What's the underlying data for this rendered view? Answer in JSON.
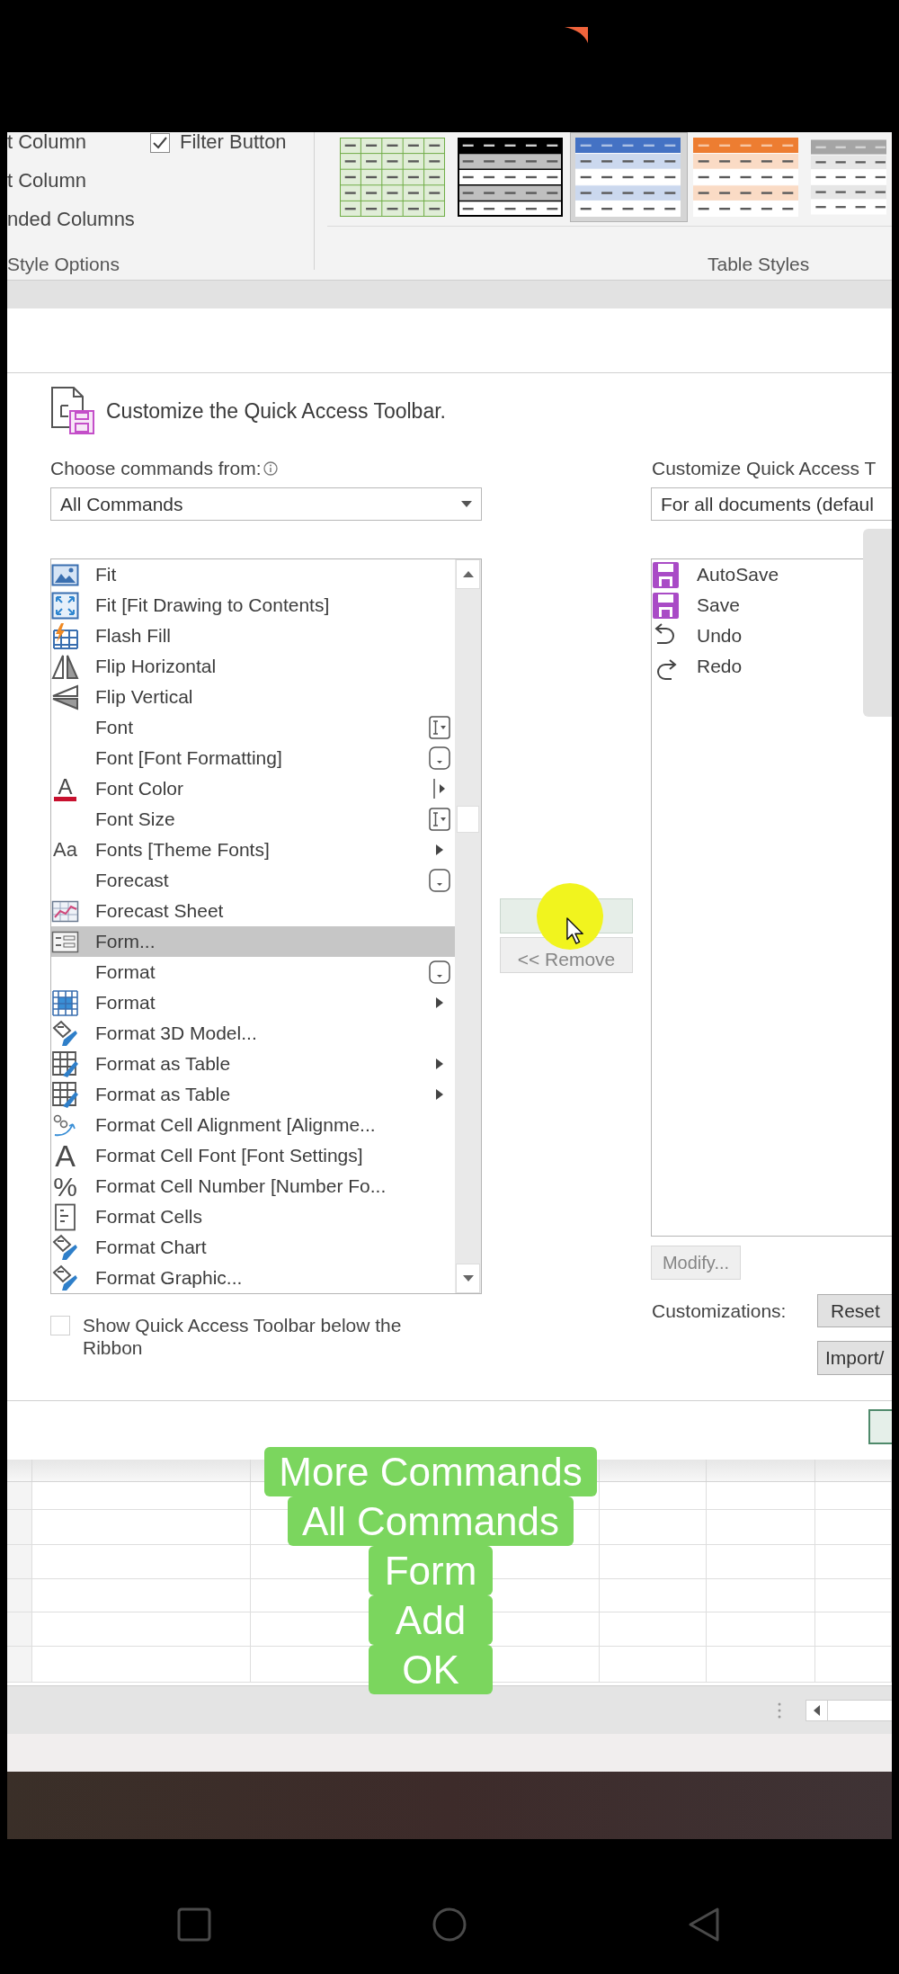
{
  "ribbon": {
    "style_options": {
      "items": [
        "t Column",
        "t Column",
        "nded Columns"
      ],
      "filter_button": {
        "label": "Filter Button",
        "checked": true
      },
      "group_label": "Style Options"
    },
    "table_styles": {
      "items": [
        {
          "kind": "light",
          "color": "#70ad47",
          "selected": false
        },
        {
          "kind": "bordered",
          "color": "#000000",
          "selected": false
        },
        {
          "kind": "banded",
          "color": "#4472c4",
          "selected": true
        },
        {
          "kind": "banded",
          "color": "#ed7d31",
          "selected": false
        },
        {
          "kind": "banded",
          "color": "#a5a5a5",
          "selected": false
        }
      ],
      "group_label": "Table Styles"
    }
  },
  "dialog": {
    "heading": "Customize the Quick Access Toolbar.",
    "choose_label": "Choose commands from:",
    "choose_value": "All Commands",
    "customize_label": "Customize Quick Access T",
    "customize_value": "For all documents (defaul",
    "commands": [
      {
        "label": "Fit",
        "kind": "plain",
        "selected": false
      },
      {
        "label": "Fit [Fit Drawing to Contents]",
        "kind": "plain",
        "selected": false
      },
      {
        "label": "Flash Fill",
        "kind": "plain",
        "selected": false
      },
      {
        "label": "Flip Horizontal",
        "kind": "plain",
        "selected": false
      },
      {
        "label": "Flip Vertical",
        "kind": "plain",
        "selected": false
      },
      {
        "label": "Font",
        "kind": "combo",
        "selected": false
      },
      {
        "label": "Font [Font Formatting]",
        "kind": "menu",
        "selected": false
      },
      {
        "label": "Font Color",
        "kind": "split",
        "selected": false,
        "glyph": "A"
      },
      {
        "label": "Font Size",
        "kind": "combo",
        "selected": false
      },
      {
        "label": "Fonts [Theme Fonts]",
        "kind": "submenu",
        "selected": false,
        "glyph": "Aa"
      },
      {
        "label": "Forecast",
        "kind": "menu",
        "selected": false
      },
      {
        "label": "Forecast Sheet",
        "kind": "plain",
        "selected": false
      },
      {
        "label": "Form...",
        "kind": "plain",
        "selected": true
      },
      {
        "label": "Format",
        "kind": "menu",
        "selected": false
      },
      {
        "label": "Format",
        "kind": "submenu",
        "selected": false
      },
      {
        "label": "Format 3D Model...",
        "kind": "plain",
        "selected": false
      },
      {
        "label": "Format as Table",
        "kind": "submenu",
        "selected": false
      },
      {
        "label": "Format as Table",
        "kind": "submenu",
        "selected": false
      },
      {
        "label": "Format Cell Alignment [Alignme...",
        "kind": "plain",
        "selected": false
      },
      {
        "label": "Format Cell Font [Font Settings]",
        "kind": "plain",
        "selected": false,
        "glyph": "A"
      },
      {
        "label": "Format Cell Number [Number Fo...",
        "kind": "plain",
        "selected": false,
        "glyph": "%"
      },
      {
        "label": "Format Cells",
        "kind": "plain",
        "selected": false
      },
      {
        "label": "Format Chart",
        "kind": "plain",
        "selected": false
      },
      {
        "label": "Format Graphic...",
        "kind": "plain",
        "selected": false
      }
    ],
    "toolbar_items": [
      {
        "label": "AutoSave"
      },
      {
        "label": "Save"
      },
      {
        "label": "Undo"
      },
      {
        "label": "Redo"
      }
    ],
    "remove_button": {
      "label": "<< Remove",
      "disabled": true
    },
    "modify_button": {
      "label": "Modify...",
      "disabled": true
    },
    "customizations_label": "Customizations:",
    "reset_button": {
      "label": "Reset"
    },
    "import_button": {
      "label": "Import/"
    },
    "show_below_ribbon": {
      "label": "Show Quick Access Toolbar below the Ribbon",
      "checked": false
    }
  },
  "caption": {
    "lines": [
      "More Commands",
      "All Commands",
      "Form",
      "Add",
      "OK"
    ]
  }
}
